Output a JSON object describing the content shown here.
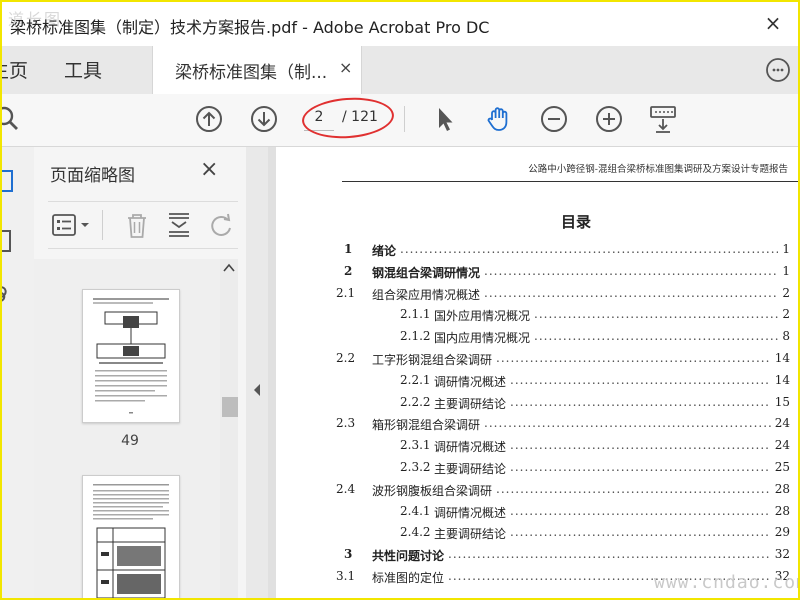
{
  "window": {
    "title": "梁桥标准图集（制定）技术方案报告.pdf - Adobe Acrobat Pro DC",
    "watermark_top": "道长图",
    "close_symbol": "×"
  },
  "menubar": {
    "home_label": "主页",
    "tools_label": "工具",
    "doc_tab_label": "梁桥标准图集（制...",
    "doc_tab_close": "×"
  },
  "toolbar": {
    "current_page": "2",
    "total_pages": "/ 121"
  },
  "thumbnail_panel": {
    "title": "页面缩略图",
    "close_symbol": "×",
    "thumb_label_1": "49"
  },
  "document": {
    "running_head": "公路中小跨径钢-混组合梁桥标准图集调研及方案设计专题报告",
    "toc_title": "目录",
    "toc": [
      {
        "num": "1",
        "text": "绪论",
        "page": "1",
        "level": 1
      },
      {
        "num": "2",
        "text": "钢混组合梁调研情况",
        "page": "1",
        "level": 1
      },
      {
        "num": "2.1",
        "text": "组合梁应用情况概述",
        "page": "2",
        "level": 2
      },
      {
        "num": "2.1.1",
        "text": "国外应用情况概况",
        "page": "2",
        "level": 3
      },
      {
        "num": "2.1.2",
        "text": "国内应用情况概况",
        "page": "8",
        "level": 3
      },
      {
        "num": "2.2",
        "text": "工字形钢混组合梁调研",
        "page": "14",
        "level": 2
      },
      {
        "num": "2.2.1",
        "text": "调研情况概述",
        "page": "14",
        "level": 3
      },
      {
        "num": "2.2.2",
        "text": "主要调研结论",
        "page": "15",
        "level": 3
      },
      {
        "num": "2.3",
        "text": "箱形钢混组合梁调研",
        "page": "24",
        "level": 2
      },
      {
        "num": "2.3.1",
        "text": "调研情况概述",
        "page": "24",
        "level": 3
      },
      {
        "num": "2.3.2",
        "text": "主要调研结论",
        "page": "25",
        "level": 3
      },
      {
        "num": "2.4",
        "text": "波形钢腹板组合梁调研",
        "page": "28",
        "level": 2
      },
      {
        "num": "2.4.1",
        "text": "调研情况概述",
        "page": "28",
        "level": 3
      },
      {
        "num": "2.4.2",
        "text": "主要调研结论",
        "page": "29",
        "level": 3
      },
      {
        "num": "3",
        "text": "共性问题讨论",
        "page": "32",
        "level": 1
      },
      {
        "num": "3.1",
        "text": "标准图的定位",
        "page": "32",
        "level": 2
      }
    ]
  },
  "watermark_bottom": "www.cndao.com"
}
